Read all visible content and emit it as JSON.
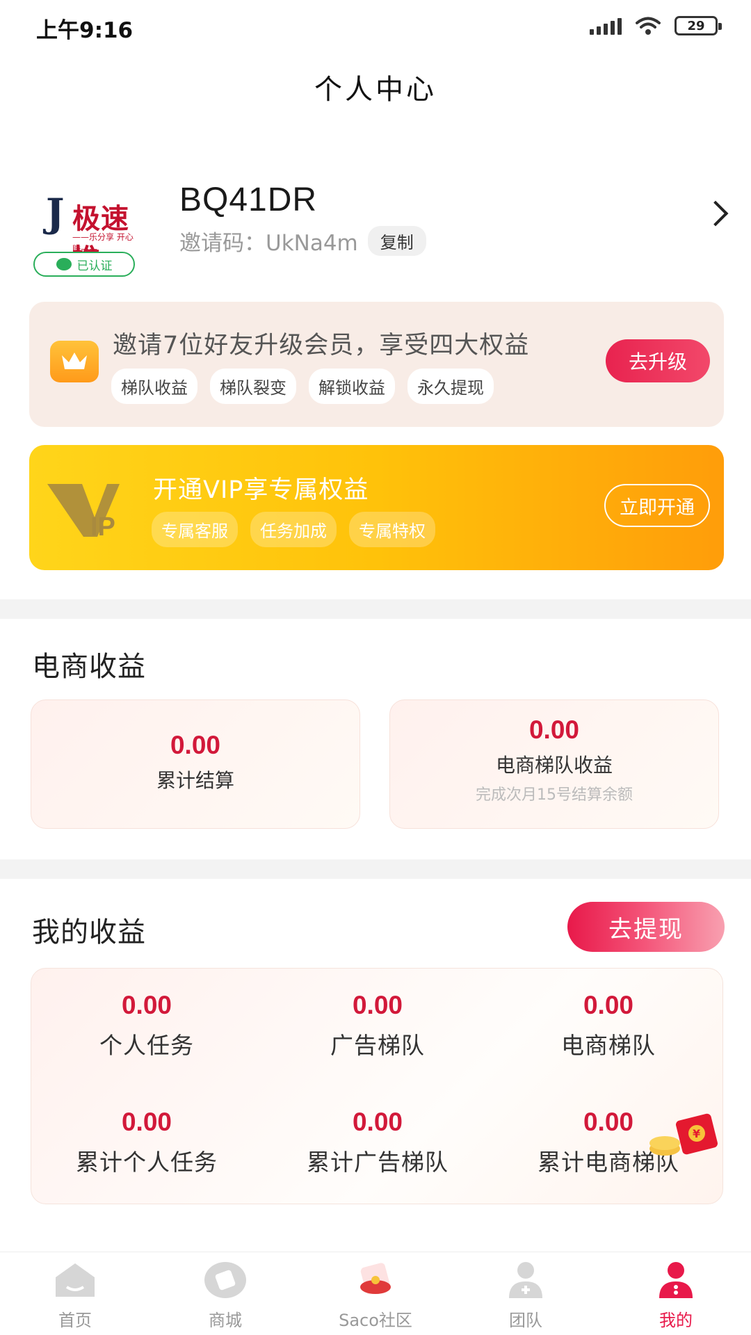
{
  "status": {
    "time": "上午9:16",
    "battery": "29"
  },
  "header": {
    "title": "个人中心"
  },
  "profile": {
    "logo_text": "极速推",
    "logo_sub": "——乐分享 开心赚——",
    "verified": "已认证",
    "username": "BQ41DR",
    "invite_label": "邀请码：UkNa4m",
    "copy": "复制"
  },
  "upgrade": {
    "title": "邀请7位好友升级会员，享受四大权益",
    "tags": [
      "梯队收益",
      "梯队裂变",
      "解锁收益",
      "永久提现"
    ],
    "button": "去升级"
  },
  "vip": {
    "title": "开通VIP享专属权益",
    "tags": [
      "专属客服",
      "任务加成",
      "专属特权"
    ],
    "button": "立即开通"
  },
  "ecommerce": {
    "title": "电商收益",
    "cards": [
      {
        "value": "0.00",
        "label": "累计结算",
        "note": ""
      },
      {
        "value": "0.00",
        "label": "电商梯队收益",
        "note": "完成次月15号结算余额"
      }
    ]
  },
  "earnings": {
    "title": "我的收益",
    "withdraw": "去提现",
    "items": [
      {
        "value": "0.00",
        "label": "个人任务"
      },
      {
        "value": "0.00",
        "label": "广告梯队"
      },
      {
        "value": "0.00",
        "label": "电商梯队"
      },
      {
        "value": "0.00",
        "label": "累计个人任务"
      },
      {
        "value": "0.00",
        "label": "累计广告梯队"
      },
      {
        "value": "0.00",
        "label": "累计电商梯队"
      }
    ]
  },
  "tabbar": {
    "tabs": [
      {
        "label": "首页",
        "icon": "home-icon"
      },
      {
        "label": "商城",
        "icon": "shop-icon"
      },
      {
        "label": "Saco社区",
        "icon": "community-icon"
      },
      {
        "label": "团队",
        "icon": "team-icon"
      },
      {
        "label": "我的",
        "icon": "profile-icon"
      }
    ],
    "active": "我的"
  },
  "colors": {
    "accent": "#e8194a",
    "value_red": "#d2193a",
    "vip_gold": "#ffc20a",
    "verified_green": "#2aae5a"
  }
}
